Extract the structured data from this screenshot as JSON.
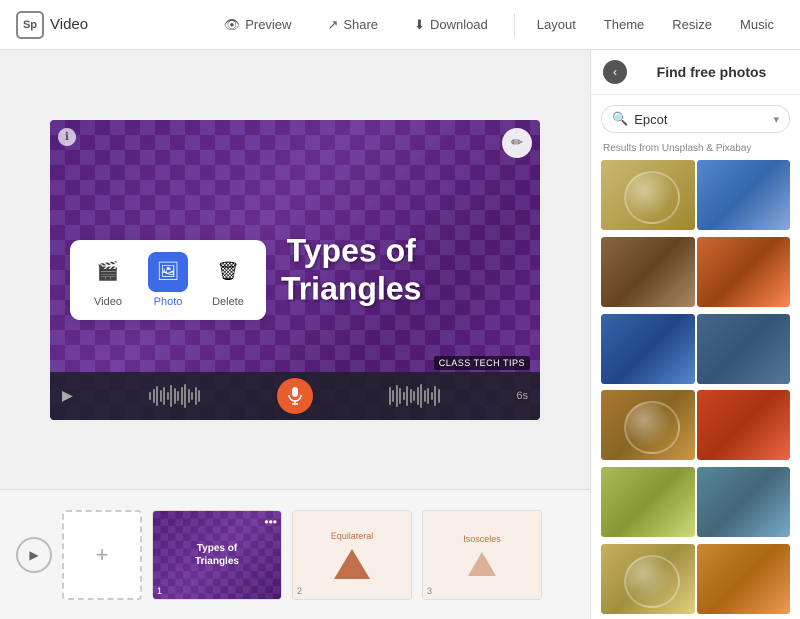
{
  "header": {
    "logo_text": "Sp",
    "app_title": "Video",
    "preview_label": "Preview",
    "share_label": "Share",
    "download_label": "Download",
    "layout_label": "Layout",
    "theme_label": "Theme",
    "resize_label": "Resize",
    "music_label": "Music"
  },
  "popup": {
    "video_label": "Video",
    "photo_label": "Photo",
    "delete_label": "Delete"
  },
  "slide": {
    "text_line1": "Types of",
    "text_line2": "Triangles",
    "badge": "CLASS TECH TIPS",
    "duration": "6s"
  },
  "timeline": {
    "thumb1_text": "Types of\nTriangles",
    "thumb1_num": "1",
    "thumb2_label": "Equilateral",
    "thumb2_num": "2",
    "thumb3_label": "Isosceles",
    "thumb3_num": "3"
  },
  "panel": {
    "back_icon": "‹",
    "title": "Find free photos",
    "search_value": "Epcot",
    "search_placeholder": "Search photos",
    "results_label": "Results from Unsplash & Pixabay",
    "dropdown_icon": "▾"
  }
}
